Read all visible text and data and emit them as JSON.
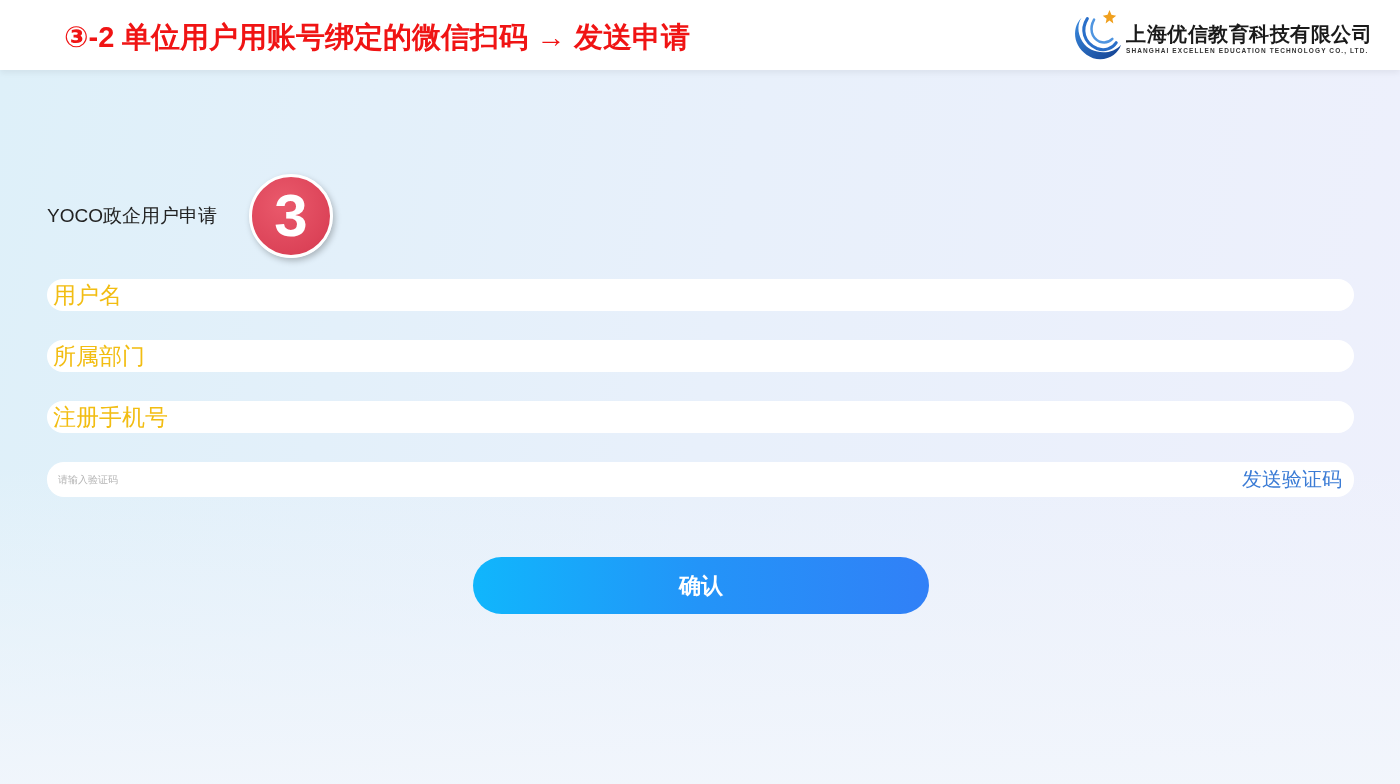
{
  "header": {
    "title": "③-2 单位用户用账号绑定的微信扫码 → 发送申请",
    "company_name": "上海优信教育科技有限公司",
    "company_name_en": "SHANGHAI EXCELLEN EDUCATION TECHNOLOGY CO., LTD."
  },
  "form": {
    "title": "YOCO政企用户申请",
    "step_marker": "3",
    "fields": [
      {
        "kind": "text",
        "placeholder": "用户名"
      },
      {
        "kind": "text",
        "placeholder": "所属部门"
      },
      {
        "kind": "text",
        "placeholder": "注册手机号"
      },
      {
        "kind": "code",
        "placeholder": "请输入验证码",
        "action": "发送验证码"
      }
    ],
    "submit_button": "确认"
  }
}
